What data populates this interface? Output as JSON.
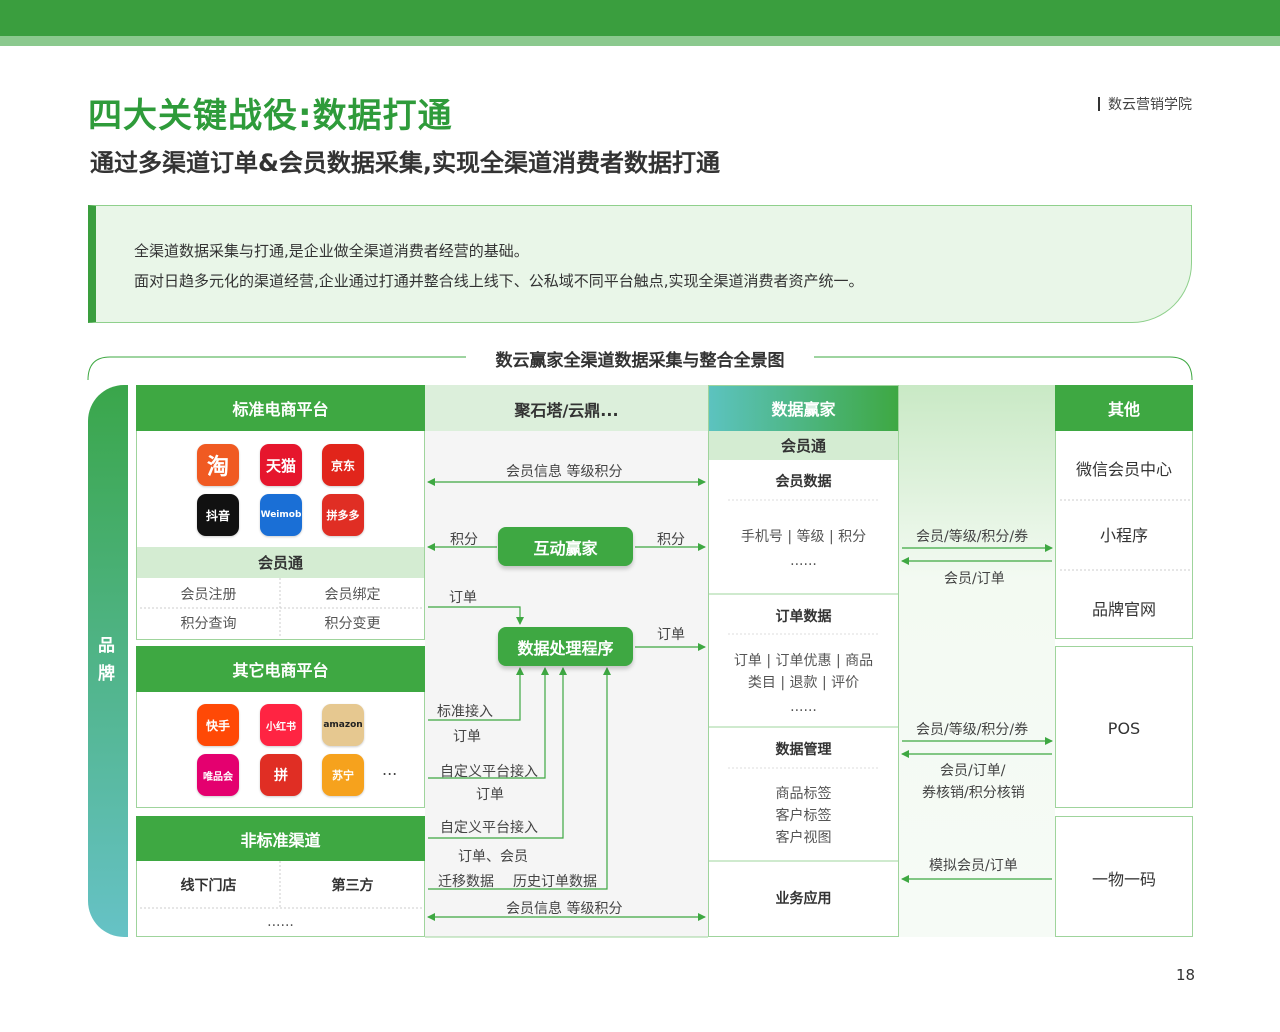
{
  "page": {
    "title": "四大关键战役:数据打通",
    "subtitle": "通过多渠道订单&会员数据采集,实现全渠道消费者数据打通",
    "brand": "数云营销学院",
    "page_number": "18"
  },
  "intro": {
    "line1": "全渠道数据采集与打通,是企业做全渠道消费者经营的基础。",
    "line2": "面对日趋多元化的渠道经营,企业通过打通并整合线上线下、公私域不同平台触点,实现全渠道消费者资产统一。"
  },
  "diagram": {
    "title": "数云赢家全渠道数据采集与整合全景图",
    "side_label": [
      "品",
      "牌"
    ],
    "col1": {
      "std_header": "标准电商平台",
      "std_apps": [
        "淘",
        "天猫",
        "京东",
        "抖音",
        "Weimob",
        "拼多多"
      ],
      "member_header": "会员通",
      "member_items": [
        "会员注册",
        "会员绑定",
        "积分查询",
        "积分变更"
      ],
      "other_header": "其它电商平台",
      "other_apps": [
        "快手",
        "小红书",
        "amazon",
        "唯品会",
        "拼",
        "苏宁"
      ],
      "ellipsis": "...",
      "nonstd_header": "非标准渠道",
      "nonstd_items": [
        "线下门店",
        "第三方"
      ],
      "nonstd_more": "......"
    },
    "col2": {
      "header": "聚石塔/云鼎...",
      "node_interact": "互动赢家",
      "node_process": "数据处理程序",
      "labels": {
        "member_info_top": "会员信息 等级积分",
        "points_left": "积分",
        "points_right": "积分",
        "order_left": "订单",
        "order_right": "订单",
        "std_access": "标准接入",
        "order_a": "订单",
        "custom_access_a": "自定义平台接入",
        "order_b": "订单",
        "custom_access_b": "自定义平台接入",
        "order_member": "订单、会员",
        "migrate": "迁移数据",
        "history": "历史订单数据",
        "member_info_bottom": "会员信息 等级积分"
      }
    },
    "col3": {
      "header": "数据赢家",
      "sub_header": "会员通",
      "member_data": {
        "title": "会员数据",
        "text": "手机号 | 等级 | 积分",
        "more": "......"
      },
      "order_data": {
        "title": "订单数据",
        "text1": "订单 | 订单优惠 | 商品",
        "text2": "类目 | 退款 | 评价",
        "more": "......"
      },
      "data_mgmt": {
        "title": "数据管理",
        "items": [
          "商品标签",
          "客户标签",
          "客户视图"
        ]
      },
      "biz_app": "业务应用"
    },
    "col4": {
      "labels": [
        "会员/等级/积分/券",
        "会员/订单",
        "会员/等级/积分/券",
        "会员/订单/",
        "券核销/积分核销",
        "模拟会员/订单"
      ]
    },
    "col5": {
      "header": "其他",
      "items": [
        "微信会员中心",
        "小程序",
        "品牌官网",
        "POS",
        "一物一码"
      ]
    }
  },
  "colors": {
    "primary": "#3ea842",
    "light": "#d4ecd2",
    "intro_bg": "#e9f6e8"
  }
}
